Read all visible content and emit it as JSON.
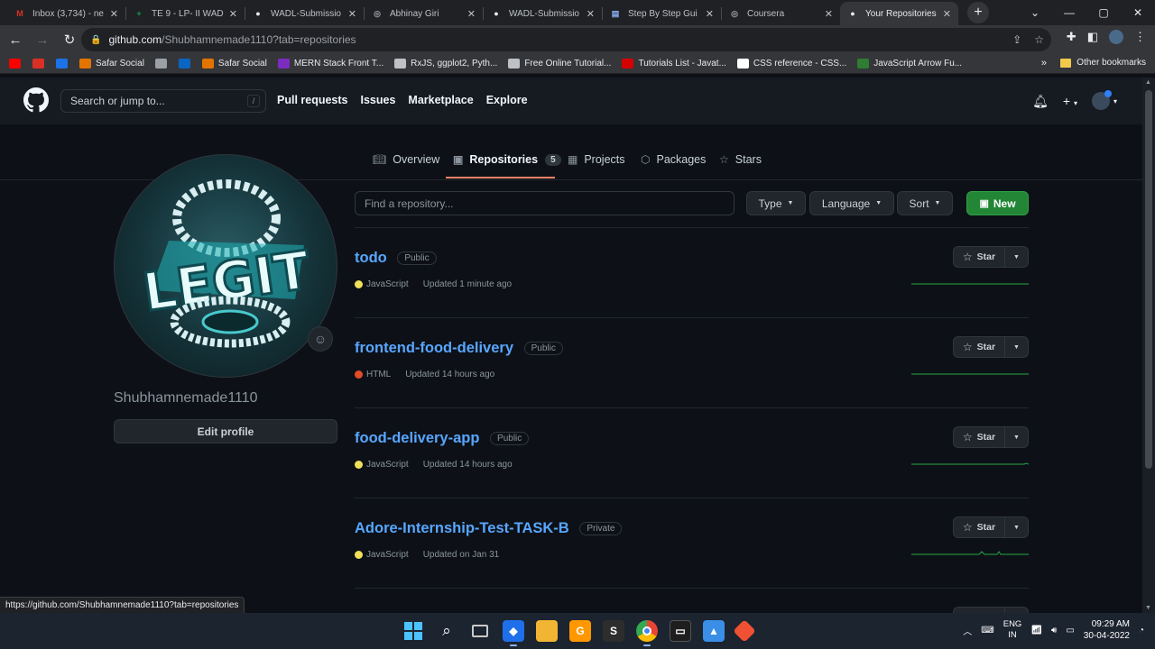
{
  "browser": {
    "tabs": [
      {
        "label": "Inbox (3,734) - ne",
        "icon": "gmail-icon",
        "color": "#d93025",
        "glyph": "M",
        "active": false
      },
      {
        "label": "TE 9 - LP- II WAD",
        "icon": "sheets-icon",
        "color": "#0f9d58",
        "glyph": "+",
        "active": false
      },
      {
        "label": "WADL-Submissio",
        "icon": "github-icon",
        "color": "#e8eaed",
        "glyph": "●",
        "active": false
      },
      {
        "label": "Abhinay Giri",
        "icon": "globe-icon",
        "color": "#9aa0a6",
        "glyph": "◎",
        "active": false
      },
      {
        "label": "WADL-Submissio",
        "icon": "github-icon",
        "color": "#e8eaed",
        "glyph": "●",
        "active": false
      },
      {
        "label": "Step By Step Gui",
        "icon": "doc-icon",
        "color": "#8ab4f8",
        "glyph": "▤",
        "active": false
      },
      {
        "label": "Coursera",
        "icon": "globe-icon",
        "color": "#9aa0a6",
        "glyph": "◎",
        "active": false
      },
      {
        "label": "Your Repositories",
        "icon": "github-icon",
        "color": "#e8eaed",
        "glyph": "●",
        "active": true
      }
    ],
    "url_host": "github.com",
    "url_rest": "/Shubhamnemade1110?tab=repositories",
    "status_url": "https://github.com/Shubhamnemade1110?tab=repositories",
    "bookmarks": [
      {
        "label": "",
        "color": "#ff0000"
      },
      {
        "label": "",
        "color": "#d93025"
      },
      {
        "label": "",
        "color": "#1a73e8"
      },
      {
        "label": "Safar Social",
        "color": "#e37400"
      },
      {
        "label": "",
        "color": "#9aa0a6"
      },
      {
        "label": "",
        "color": "#0a66c2"
      },
      {
        "label": "Safar Social",
        "color": "#e37400"
      },
      {
        "label": "MERN Stack Front T...",
        "color": "#7b2cbf"
      },
      {
        "label": "RxJS, ggplot2, Pyth...",
        "color": "#bdc1c6"
      },
      {
        "label": "Free Online Tutorial...",
        "color": "#bdc1c6"
      },
      {
        "label": "Tutorials List - Javat...",
        "color": "#d50000"
      },
      {
        "label": "CSS reference - CSS...",
        "color": "#ffffff"
      },
      {
        "label": "JavaScript Arrow Fu...",
        "color": "#2e7d32"
      }
    ],
    "bookmarks_more": "»",
    "other_bookmarks": "Other bookmarks"
  },
  "github": {
    "search_placeholder": "Search or jump to...",
    "search_key": "/",
    "nav": [
      "Pull requests",
      "Issues",
      "Marketplace",
      "Explore"
    ],
    "profile_tabs": [
      {
        "label": "Overview",
        "icon": "book-icon"
      },
      {
        "label": "Repositories",
        "icon": "repo-icon",
        "count": "5"
      },
      {
        "label": "Projects",
        "icon": "table-icon"
      },
      {
        "label": "Packages",
        "icon": "package-icon"
      },
      {
        "label": "Stars",
        "icon": "star-icon"
      }
    ],
    "username": "Shubhamnemade1110",
    "edit_profile": "Edit profile",
    "find_placeholder": "Find a repository...",
    "filters": {
      "type": "Type",
      "language": "Language",
      "sort": "Sort",
      "new": "New"
    },
    "star_label": "Star",
    "repos": [
      {
        "name": "todo",
        "visibility": "Public",
        "language": "JavaScript",
        "lang_color": "#f1e05a",
        "updated": "Updated 1 minute ago"
      },
      {
        "name": "frontend-food-delivery",
        "visibility": "Public",
        "language": "HTML",
        "lang_color": "#e34c26",
        "updated": "Updated 14 hours ago"
      },
      {
        "name": "food-delivery-app",
        "visibility": "Public",
        "language": "JavaScript",
        "lang_color": "#f1e05a",
        "updated": "Updated 14 hours ago"
      },
      {
        "name": "Adore-Internship-Test-TASK-B",
        "visibility": "Private",
        "language": "JavaScript",
        "lang_color": "#f1e05a",
        "updated": "Updated on Jan 31"
      }
    ]
  },
  "taskbar": {
    "lang_top": "ENG",
    "lang_bottom": "IN",
    "time": "09:29 AM",
    "date": "30-04-2022"
  }
}
